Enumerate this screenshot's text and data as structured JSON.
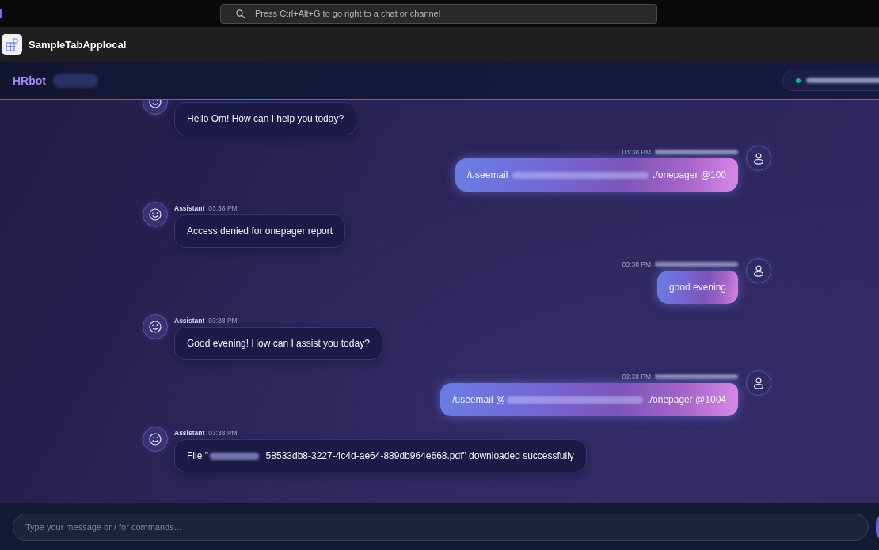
{
  "title_bar": {
    "search": {
      "placeholder": "Press Ctrl+Alt+G to go right to a chat or channel"
    }
  },
  "app_bar": {
    "title": "SampleTabApplocal"
  },
  "chat_header": {
    "bot_name": "HRbot",
    "bot_tag": {
      "kind": "redacted"
    },
    "user_chip": {
      "online": true,
      "email": {
        "kind": "redacted"
      }
    }
  },
  "messages": [
    {
      "kind": "assistant",
      "parts": [
        {
          "kind": "text",
          "text": "Hello Om! How can I help you today?"
        }
      ]
    },
    {
      "kind": "user",
      "time": "03:38 PM",
      "sender": {
        "kind": "redacted"
      },
      "parts": [
        {
          "kind": "text",
          "text": "/useemail "
        },
        {
          "kind": "redacted"
        },
        {
          "kind": "text",
          "text": " ./onepager @100"
        }
      ]
    },
    {
      "kind": "assistant",
      "sender": {
        "kind": "text",
        "text": "Assistant"
      },
      "time": "03:38 PM",
      "parts": [
        {
          "kind": "text",
          "text": "Access denied for onepager report"
        }
      ]
    },
    {
      "kind": "user",
      "time": "03:38 PM",
      "sender": {
        "kind": "redacted"
      },
      "parts": [
        {
          "kind": "text",
          "text": "good evening"
        }
      ]
    },
    {
      "kind": "assistant",
      "sender": {
        "kind": "text",
        "text": "Assistant"
      },
      "time": "03:38 PM",
      "parts": [
        {
          "kind": "text",
          "text": "Good evening! How can I assist you today?"
        }
      ]
    },
    {
      "kind": "user",
      "time": "03:38 PM",
      "sender": {
        "kind": "redacted"
      },
      "parts": [
        {
          "kind": "text",
          "text": "/useemail @"
        },
        {
          "kind": "redacted"
        },
        {
          "kind": "text",
          "text": " ./onepager @1004"
        }
      ]
    },
    {
      "kind": "assistant",
      "sender": {
        "kind": "text",
        "text": "Assistant"
      },
      "time": "03:38 PM",
      "parts": [
        {
          "kind": "text",
          "text": "File \""
        },
        {
          "kind": "redacted"
        },
        {
          "kind": "text",
          "text": "_58533db8-3227-4c4d-ae64-889db964e668.pdf\" downloaded successfully"
        }
      ]
    }
  ],
  "composer": {
    "placeholder": "Type your message or / for commands..."
  }
}
